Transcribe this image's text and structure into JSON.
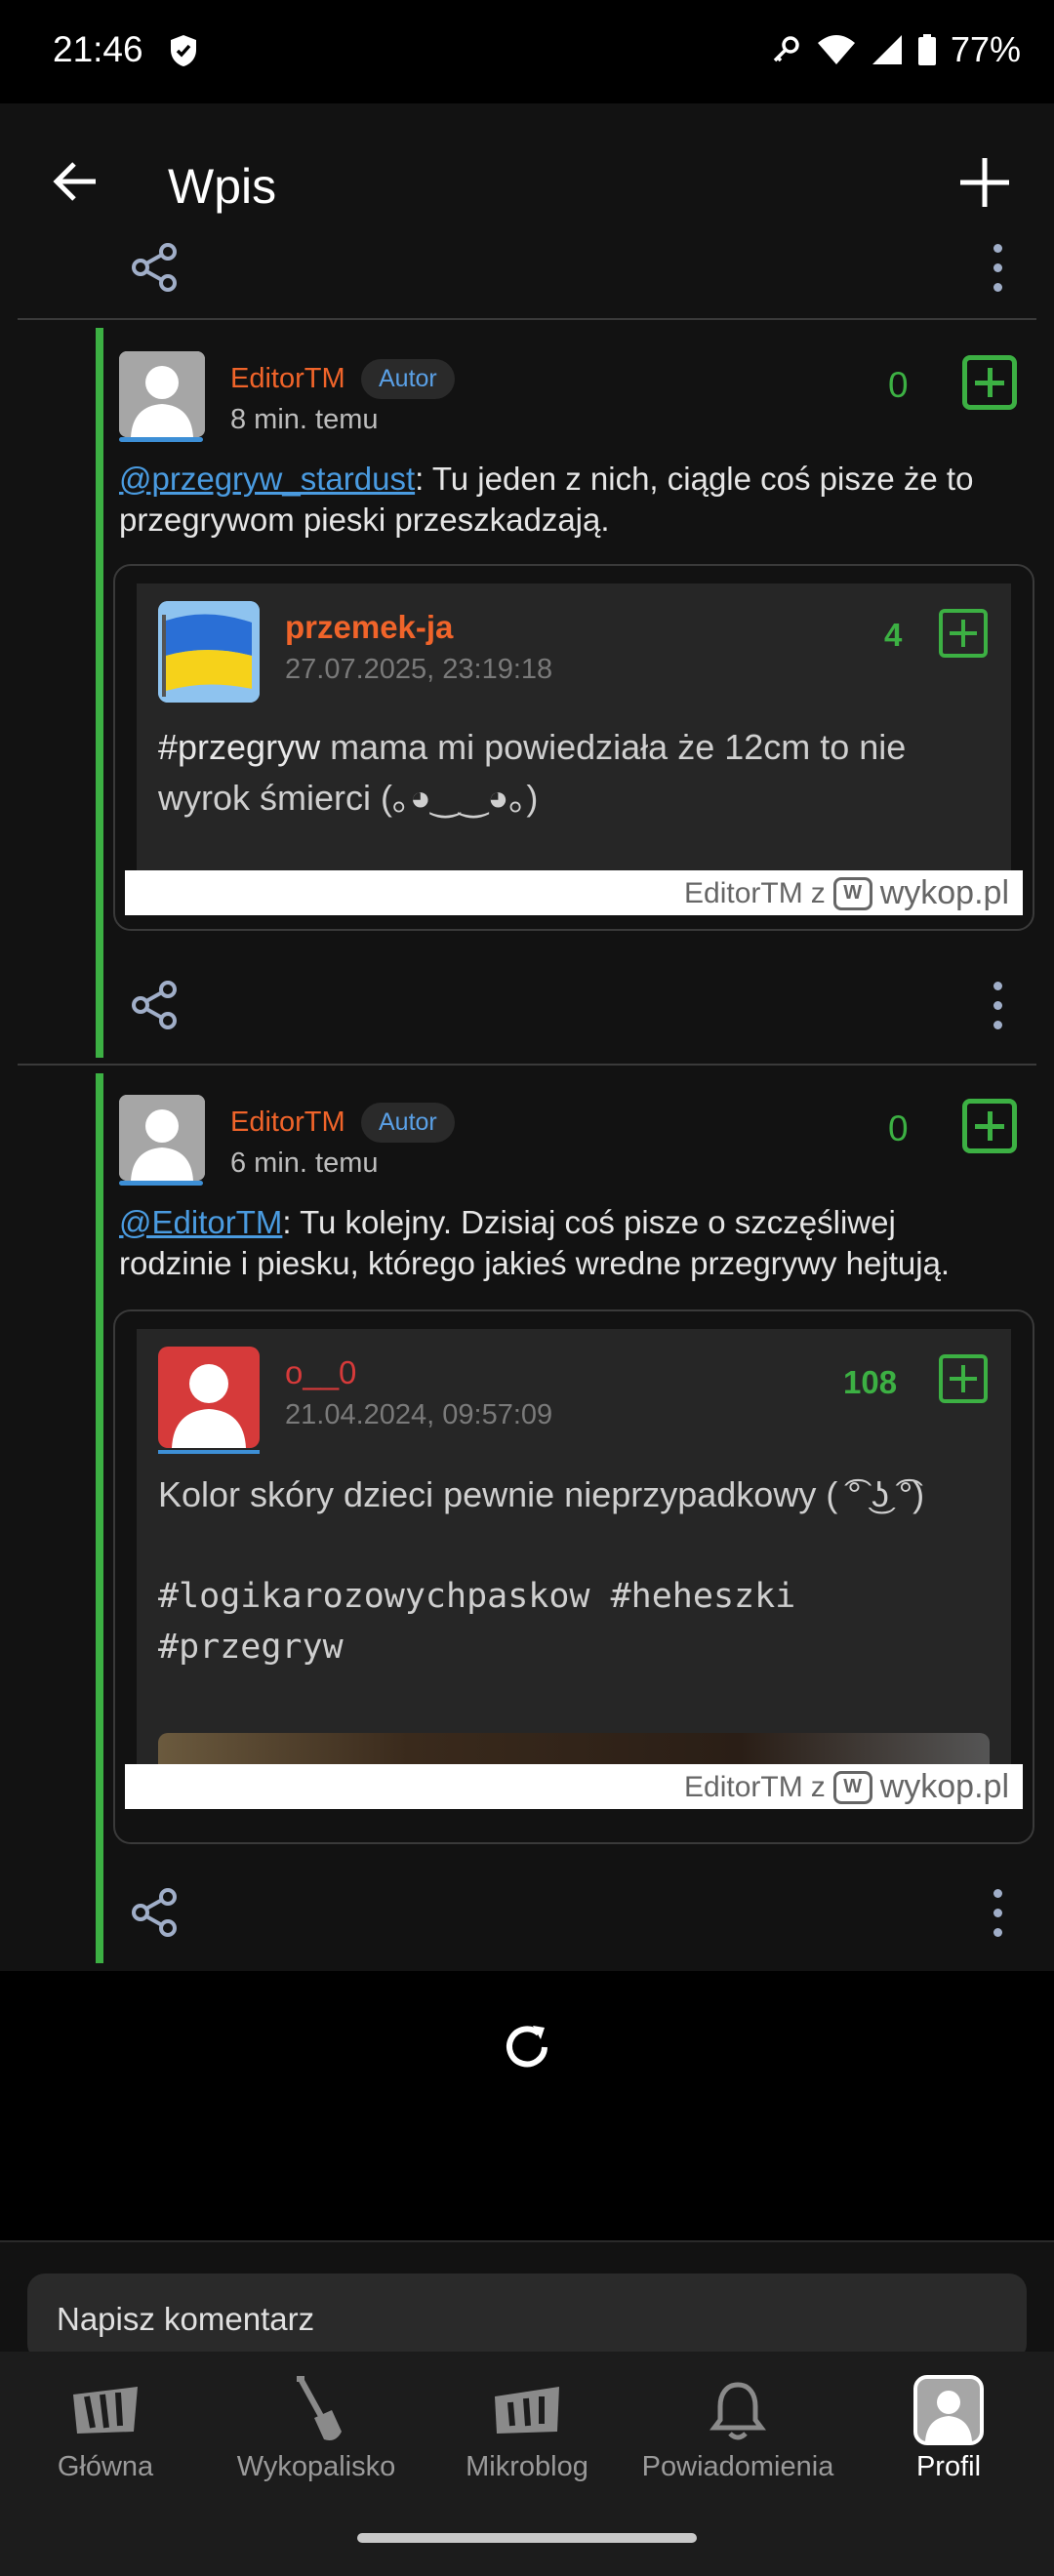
{
  "status_bar": {
    "time": "21:46",
    "battery": "77%"
  },
  "app_bar": {
    "title": "Wpis"
  },
  "comments": [
    {
      "author": "EditorTM",
      "badge": "Autor",
      "time": "8 min. temu",
      "votes": "0",
      "mention": "@przegryw_stardust",
      "text_line1_rest": ": Tu jeden z nich, ciągle coś pisze że to",
      "text_line2": "przegrywom pieski przeszkadzają.",
      "embed": {
        "author": "przemek-ja",
        "date": "27.07.2025, 23:19:18",
        "votes": "4",
        "tag": "#przegryw",
        "text_line1_rest": " mama mi powiedziała że 12cm to nie",
        "text_line2": "wyrok śmierci (｡◕‿‿◕｡)",
        "footer_by": "EditorTM",
        "footer_z": "z",
        "footer_site": "wykop.pl"
      }
    },
    {
      "author": "EditorTM",
      "badge": "Autor",
      "time": "6 min. temu",
      "votes": "0",
      "mention": "@EditorTM",
      "text_line1_rest": ": Tu kolejny. Dzisiaj coś pisze o szczęśliwej",
      "text_line2": "rodzinie i piesku, którego jakieś wredne przegrywy hejtują.",
      "embed": {
        "author": "o__0",
        "date": "21.04.2024, 09:57:09",
        "votes": "108",
        "text_line1": "Kolor skóry dzieci pewnie nieprzypadkowy ( ͡° ͜ʖ ͡°)",
        "text_line2": "#logikarozowychpaskow #heheszki",
        "text_line3": "#przegryw",
        "footer_by": "EditorTM",
        "footer_z": "z",
        "footer_site": "wykop.pl"
      }
    }
  ],
  "comment_input": {
    "placeholder": "Napisz komentarz"
  },
  "bottom_nav": [
    {
      "label": "Główna"
    },
    {
      "label": "Wykopalisko"
    },
    {
      "label": "Mikroblog"
    },
    {
      "label": "Powiadomienia"
    },
    {
      "label": "Profil"
    }
  ],
  "colors": {
    "accent_green": "#3cb043",
    "author_orange": "#f0642a",
    "mention_blue": "#4a9be0"
  }
}
